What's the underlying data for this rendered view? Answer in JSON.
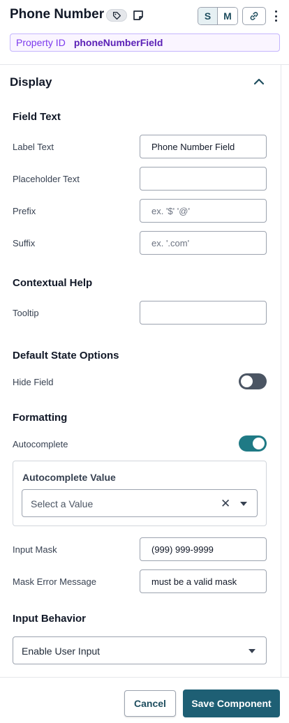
{
  "header": {
    "title": "Phone Number",
    "mode_buttons": [
      "S",
      "M"
    ],
    "active_mode": "S",
    "property_id_label": "Property ID",
    "property_id_value": "phoneNumberField"
  },
  "section": {
    "title": "Display",
    "expanded": true
  },
  "field_text": {
    "title": "Field Text",
    "label_text": {
      "label": "Label Text",
      "value": "Phone Number Field",
      "placeholder": ""
    },
    "placeholder_text": {
      "label": "Placeholder Text",
      "value": "",
      "placeholder": ""
    },
    "prefix": {
      "label": "Prefix",
      "value": "",
      "placeholder": "ex. '$' '@'"
    },
    "suffix": {
      "label": "Suffix",
      "value": "",
      "placeholder": "ex. '.com'"
    }
  },
  "contextual_help": {
    "title": "Contextual Help",
    "tooltip": {
      "label": "Tooltip",
      "value": "",
      "placeholder": ""
    }
  },
  "default_state": {
    "title": "Default State Options",
    "hide_field": {
      "label": "Hide Field",
      "on": false
    }
  },
  "formatting": {
    "title": "Formatting",
    "autocomplete": {
      "label": "Autocomplete",
      "on": true
    },
    "autocomplete_value": {
      "title": "Autocomplete Value",
      "placeholder": "Select a Value"
    },
    "input_mask": {
      "label": "Input Mask",
      "value": "(999) 999-9999",
      "placeholder": ""
    },
    "mask_error": {
      "label": "Mask Error Message",
      "value": "must be a valid mask",
      "placeholder": ""
    }
  },
  "input_behavior": {
    "title": "Input Behavior",
    "selected": "Enable User Input"
  },
  "footer": {
    "cancel_label": "Cancel",
    "save_label": "Save Component"
  },
  "colors": {
    "primary": "#1e5f74",
    "toggle_on": "#1f7a85",
    "toggle_off": "#4b5563",
    "property_accent": "#7c3aed"
  },
  "icons": [
    "tag-icon",
    "note-icon",
    "link-icon",
    "kebab-menu-icon",
    "chevron-up-icon",
    "clear-icon",
    "caret-down-icon"
  ]
}
